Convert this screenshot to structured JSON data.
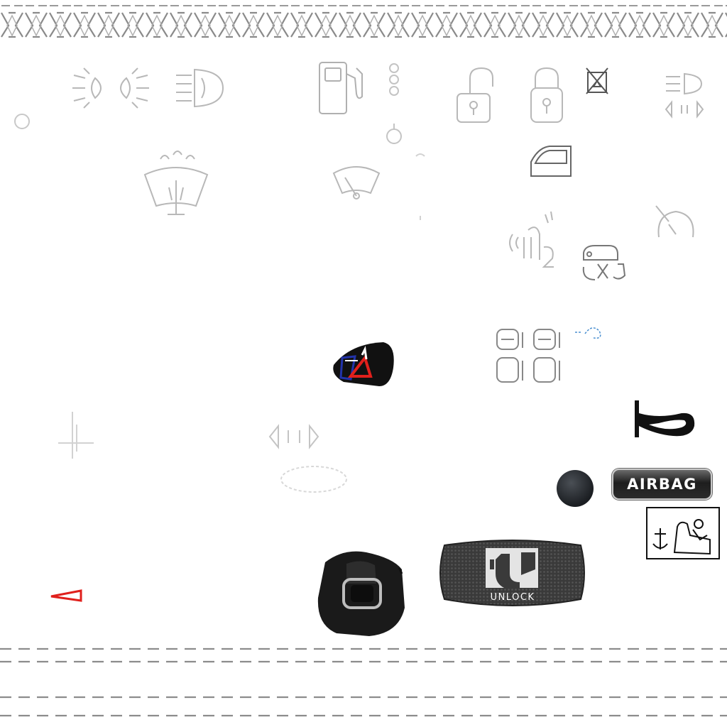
{
  "labels": {
    "airbag": "AIRBAG",
    "unlock": "UNLOCK"
  },
  "icons": [
    "tire-tread-strip-top-icon",
    "position-lights-icon",
    "front-fog-light-icon",
    "fuel-pump-icon",
    "padlock-open-icon",
    "padlock-closed-icon",
    "no-jack-icon",
    "headlight-range-icon",
    "windshield-washer-icon",
    "rear-wiper-icon",
    "door-open-icon",
    "noise-vibration-icon",
    "engine-service-icon",
    "speed-limiter-icon",
    "seat-belt-reminder-icon",
    "power-window-switches-icon",
    "horn-icon",
    "airbag-badge-icon",
    "rotary-knob-icon",
    "isofix-child-seat-icon",
    "seat-belt-buckle-icon",
    "unlock-button-icon",
    "warning-triangle-icon",
    "dashed-lines-bottom-icon"
  ],
  "colors": {
    "outline": "#b8b8b8",
    "dark": "#1a1a1a",
    "red": "#e0201c",
    "blue": "#2233aa"
  }
}
